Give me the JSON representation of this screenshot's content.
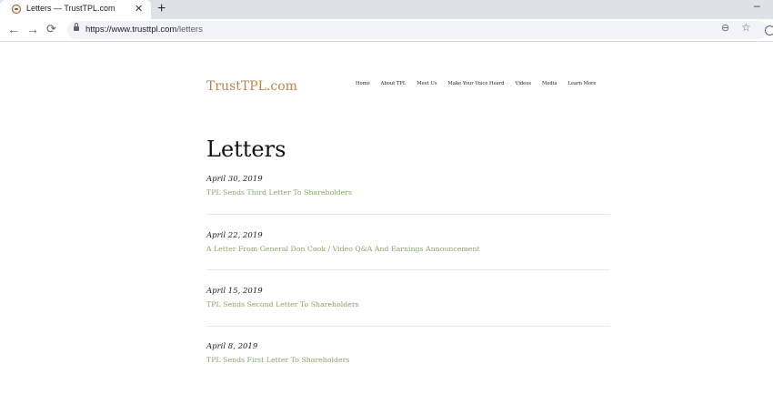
{
  "browser": {
    "tab_title": "Letters — TrustTPL.com",
    "tab_close": "✕",
    "new_tab": "+",
    "minimize": "–",
    "url_host": "https://www.trusttpl.com",
    "url_path": "/letters",
    "icons": {
      "back": "←",
      "forward": "→",
      "reload": "⟳",
      "zoom": "⊖",
      "star": "☆"
    }
  },
  "site": {
    "logo": "TrustTPL.com",
    "nav": [
      "Home",
      "About TPL",
      "Meet Us",
      "Make Your Voice Heard",
      "Videos",
      "Media",
      "Learn More"
    ]
  },
  "page": {
    "title": "Letters",
    "letters": [
      {
        "date": "April 30, 2019",
        "title": "TPL Sends Third Letter To Shareholders"
      },
      {
        "date": "April 22, 2019",
        "title": "A Letter From General Don Cook / Video Q&A And Earnings Announcement"
      },
      {
        "date": "April 15, 2019",
        "title": "TPL Sends Second Letter To Shareholders"
      },
      {
        "date": "April 8, 2019",
        "title": "TPL Sends First Letter To Shareholders"
      }
    ]
  }
}
